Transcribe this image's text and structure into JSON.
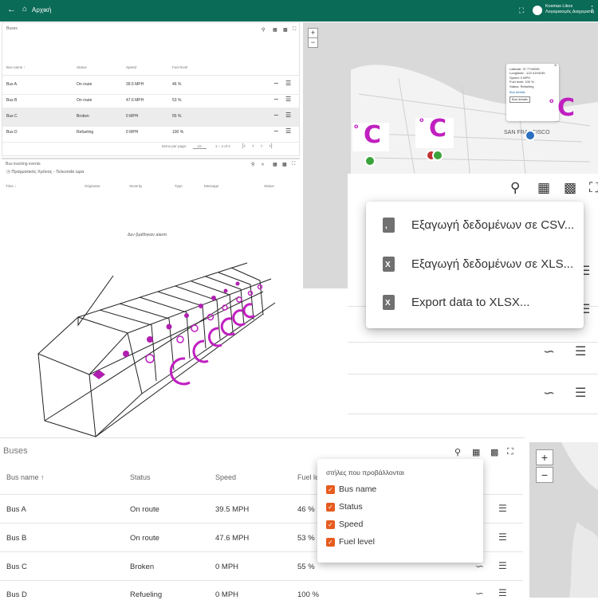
{
  "appbar": {
    "back_icon": "arrow-left-icon",
    "home_icon": "home-icon",
    "title": "Αρχική",
    "user_line1": "Kosmas Likos",
    "user_line2": "Λογαριασμός Διαχειριστή"
  },
  "small_panel": {
    "title": "Buses",
    "columns": [
      "Bus name ↑",
      "Status",
      "Speed",
      "Fuel level"
    ],
    "rows": [
      {
        "name": "Bus A",
        "status": "On route",
        "speed": "39.5 MPH",
        "fuel": "46 %"
      },
      {
        "name": "Bus B",
        "status": "On route",
        "speed": "47.6 MPH",
        "fuel": "53 %"
      },
      {
        "name": "Bus C",
        "status": "Broken",
        "speed": "0 MPH",
        "fuel": "55 %"
      },
      {
        "name": "Bus D",
        "status": "Refueling",
        "speed": "0 MPH",
        "fuel": "100 %"
      }
    ],
    "rows_per_page_label": "Items per page:",
    "rows_per_page_value": "10",
    "range": "1 – 4 of 4"
  },
  "events_panel": {
    "title": "Bus tracking events",
    "time_range": "Πραγματικός Χρόνος - Τελευταία ώρα",
    "columns": [
      "Time ↓",
      "Originator",
      "Severity",
      "Type",
      "Message",
      "Status"
    ],
    "empty": "Δεν βρέθηκαν alarm"
  },
  "map": {
    "zoom_in": "+",
    "zoom_out": "−",
    "city_label": "SAN FRANCISCO",
    "popup": {
      "lines": [
        "Latitude: 37.7749295",
        "Longitude: -122.4194155",
        "Speed: 0 MPH",
        "Fuel level: 100 %",
        "Status: Refueling"
      ],
      "link": "Bus details",
      "button": "Bus details"
    }
  },
  "export_menu": {
    "items": [
      {
        "icon": "csv-file-icon",
        "glyph": ",",
        "label": "Εξαγωγή δεδομένων σε CSV..."
      },
      {
        "icon": "xls-file-icon",
        "glyph": "X",
        "label": "Εξαγωγή δεδομένων σε XLS..."
      },
      {
        "icon": "xlsx-file-icon",
        "glyph": "X",
        "label": "Export data to XLSX..."
      }
    ]
  },
  "bottom_table": {
    "title": "Buses",
    "columns": [
      "Bus name ↑",
      "Status",
      "Speed",
      "Fuel level"
    ],
    "rows": [
      {
        "name": "Bus A",
        "status": "On route",
        "speed": "39.5 MPH",
        "fuel": "46 %"
      },
      {
        "name": "Bus B",
        "status": "On route",
        "speed": "47.6 MPH",
        "fuel": "53 %"
      },
      {
        "name": "Bus C",
        "status": "Broken",
        "speed": "0 MPH",
        "fuel": "55 %"
      },
      {
        "name": "Bus D",
        "status": "Refueling",
        "speed": "0 MPH",
        "fuel": "100 %"
      }
    ]
  },
  "columns_popover": {
    "title": "στήλες που προβάλλονται",
    "options": [
      "Bus name",
      "Status",
      "Speed",
      "Fuel level"
    ]
  },
  "map2": {
    "zoom_in": "+",
    "zoom_out": "−"
  },
  "colors": {
    "appbar": "#0a6b57",
    "checkbox": "#e65c1e",
    "overlay_rings": "#c020c0"
  }
}
